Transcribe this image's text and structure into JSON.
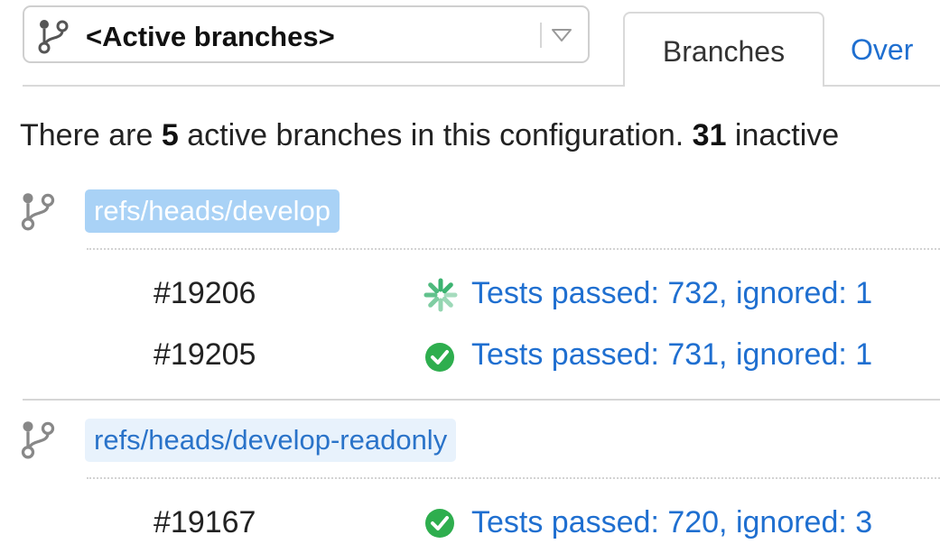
{
  "selector": {
    "label": "<Active branches>",
    "icon": "branch-icon",
    "dropdown_icon": "triangle-down-icon"
  },
  "tabs": [
    {
      "label": "Branches",
      "active": true
    },
    {
      "label": "Over",
      "active": false
    }
  ],
  "summary": {
    "prefix": "There are ",
    "active_count": "5",
    "middle": " active branches in this configuration. ",
    "inactive_count": "31",
    "suffix": " inactive"
  },
  "branches": [
    {
      "name": "refs/heads/develop",
      "icon": "branch-icon",
      "highlight_color": "#a9d2f6",
      "builds": [
        {
          "number": "#19206",
          "status": "Tests passed: 732, ignored: 1",
          "status_icon": "running-spinner-icon",
          "status_color": "#3cb371"
        },
        {
          "number": "#19205",
          "status": "Tests passed: 731, ignored: 1",
          "status_icon": "success-check-icon",
          "status_color": "#2eae4e"
        }
      ]
    },
    {
      "name": "refs/heads/develop-readonly",
      "icon": "branch-icon",
      "highlight_color": "#e8f2fc",
      "builds": [
        {
          "number": "#19167",
          "status": "Tests passed: 720, ignored: 3",
          "status_icon": "success-check-icon",
          "status_color": "#2eae4e"
        }
      ]
    }
  ],
  "colors": {
    "link": "#1f6fd0",
    "border": "#d9d9d9",
    "success": "#2eae4e"
  }
}
